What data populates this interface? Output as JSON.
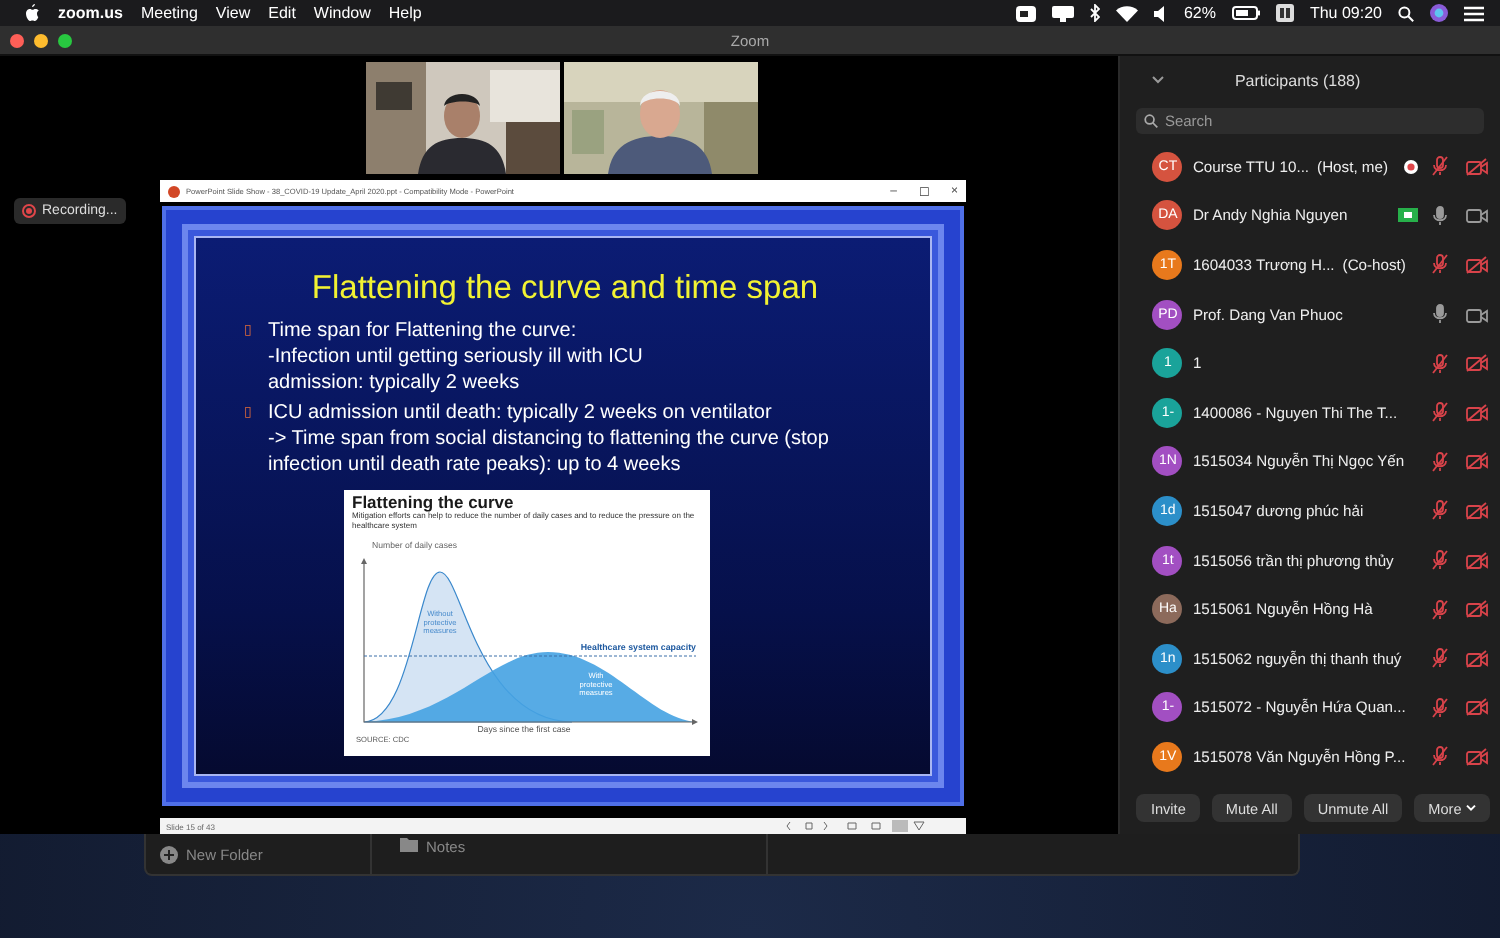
{
  "menu_bar": {
    "app": "zoom.us",
    "menus": [
      "Meeting",
      "View",
      "Edit",
      "Window",
      "Help"
    ],
    "battery": "62%",
    "clock": "Thu 09:20"
  },
  "window": {
    "title": "Zoom"
  },
  "recording": {
    "label": "Recording..."
  },
  "shared_window": {
    "title": "PowerPoint Slide Show - 38_COVID-19 Update_April 2020.ppt - Compatibility Mode - PowerPoint",
    "controls": [
      "–",
      "☐",
      "×"
    ],
    "status": "Slide 15 of 43"
  },
  "slide": {
    "title": "Flattening the curve and time span",
    "bullets": [
      {
        "marker": "▯",
        "text": "Time span for Flattening the curve:",
        "lines": [
          "-Infection until getting seriously ill with ICU admission: typically 2 weeks"
        ]
      },
      {
        "marker": "▯",
        "text": "ICU admission until death: typically 2 weeks on ventilator",
        "lines": [
          "-> Time span from social distancing to flattening the curve (stop infection until death rate peaks): up to 4 weeks"
        ]
      }
    ],
    "figure": {
      "title": "Flattening the curve",
      "subtitle": "Mitigation efforts can help to reduce the number of daily cases and to reduce the pressure on the healthcare system",
      "ylabel": "Number of daily cases",
      "xlabel": "Days since the first case",
      "peak_label": [
        "Without",
        "protective",
        "measures"
      ],
      "capacity_label": "Healthcare system capacity",
      "flat_label": [
        "With",
        "protective",
        "measures"
      ],
      "source": "SOURCE: CDC"
    }
  },
  "participants": {
    "title": "Participants (188)",
    "search": {
      "placeholder": "Search"
    },
    "list": [
      {
        "initials": "CT",
        "color": "#d5533f",
        "name": "Course TTU 10...",
        "role": "(Host, me)",
        "recording": true,
        "sharing": false,
        "muted": true,
        "video_off": true
      },
      {
        "initials": "DA",
        "color": "#d5533f",
        "name": "Dr Andy Nghia Nguyen",
        "recording": false,
        "sharing": true,
        "muted": false,
        "video_off": false
      },
      {
        "initials": "1T",
        "color": "#e8791c",
        "name": "1604033 Trương H...",
        "role": "(Co-host)",
        "muted": true,
        "video_off": true
      },
      {
        "initials": "PD",
        "color": "#a24fc2",
        "name": "Prof. Dang Van Phuoc",
        "muted": false,
        "video_off": false
      },
      {
        "initials": "1",
        "color": "#1aa39a",
        "name": "1",
        "muted": true,
        "video_off": true
      },
      {
        "initials": "1-",
        "color": "#1aa39a",
        "name": "1400086 - Nguyen Thi The T...",
        "muted": true,
        "video_off": true
      },
      {
        "initials": "1N",
        "color": "#a24fc2",
        "name": "1515034 Nguyễn Thị Ngọc Yến",
        "muted": true,
        "video_off": true
      },
      {
        "initials": "1d",
        "color": "#2c8fc9",
        "name": "1515047 dương phúc hải",
        "muted": true,
        "video_off": true
      },
      {
        "initials": "1t",
        "color": "#a24fc2",
        "name": "1515056 trần thị phương thủy",
        "muted": true,
        "video_off": true
      },
      {
        "initials": "Ha",
        "color": "#8c6a5b",
        "name": "1515061 Nguyễn Hồng Hà",
        "muted": true,
        "video_off": true
      },
      {
        "initials": "1n",
        "color": "#2c8fc9",
        "name": "1515062 nguyễn thị thanh thuý",
        "muted": true,
        "video_off": true
      },
      {
        "initials": "1-",
        "color": "#a24fc2",
        "name": "1515072 - Nguyễn Hứa Quan...",
        "muted": true,
        "video_off": true
      },
      {
        "initials": "1V",
        "color": "#e8791c",
        "name": "1515078 Văn Nguyễn Hồng P...",
        "muted": true,
        "video_off": true
      }
    ],
    "buttons": [
      "Invite",
      "Mute All",
      "Unmute All",
      "More"
    ]
  },
  "finder": {
    "items": [
      {
        "kind": "new-folder",
        "label": "New Folder"
      },
      {
        "kind": "folder",
        "label": "Notes"
      }
    ]
  }
}
